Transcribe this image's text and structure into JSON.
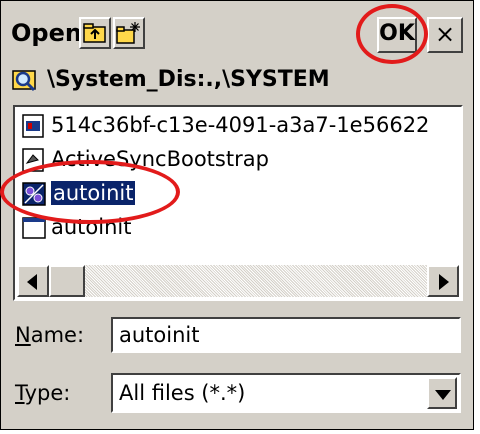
{
  "dialog": {
    "title": "Open",
    "ok_label": "OK",
    "close_label": "×",
    "path": "\\System_Dis:.,\\SYSTEM"
  },
  "files": [
    {
      "name": "514c36bf-c13e-4091-a3a7-1e56622",
      "icon": "system-file-icon",
      "selected": false
    },
    {
      "name": "ActiveSyncBootstrap",
      "icon": "document-icon",
      "selected": false
    },
    {
      "name": "autoinit",
      "icon": "config-file-icon",
      "selected": true
    },
    {
      "name": "autoinit",
      "icon": "window-file-icon",
      "selected": false
    }
  ],
  "form": {
    "name_label_underlined": "N",
    "name_label_rest": "ame:",
    "name_value": "autoinit",
    "type_label_underlined": "T",
    "type_label_rest": "ype:",
    "type_value": "All files (*.*)"
  },
  "colors": {
    "selection": "#0a246a",
    "annotation": "#e21b1b",
    "dialog_bg": "#d4d0c8"
  }
}
